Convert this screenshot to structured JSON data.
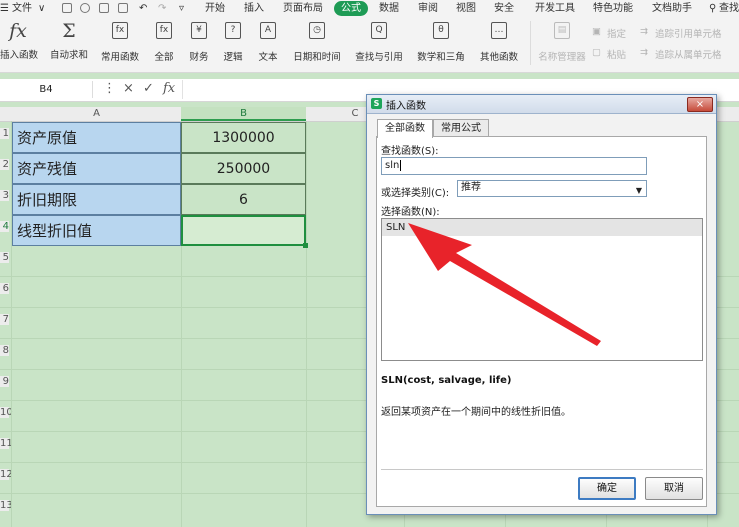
{
  "menubar": {
    "items": [
      "文件",
      "开始",
      "插入",
      "页面布局",
      "公式",
      "数据",
      "审阅",
      "视图",
      "安全",
      "开发工具",
      "特色功能",
      "文档助手",
      "查找"
    ],
    "active": "公式",
    "active_color": "#1e9b55"
  },
  "ribbon": {
    "buttons": [
      {
        "label": "插入函数",
        "icon": "fx"
      },
      {
        "label": "自动求和",
        "icon": "Σ"
      },
      {
        "label": "常用函数",
        "icon": "fx"
      },
      {
        "label": "全部",
        "icon": "fx"
      },
      {
        "label": "财务",
        "icon": "¥"
      },
      {
        "label": "逻辑",
        "icon": "?"
      },
      {
        "label": "文本",
        "icon": "A"
      },
      {
        "label": "日期和时间",
        "icon": "◷"
      },
      {
        "label": "查找与引用",
        "icon": "Q"
      },
      {
        "label": "数学和三角",
        "icon": "θ"
      },
      {
        "label": "其他函数",
        "icon": "…"
      },
      {
        "label": "名称管理器",
        "icon": "▤"
      }
    ],
    "side": [
      "指定",
      "粘贴",
      "追踪引用单元格",
      "追踪从属单元格"
    ]
  },
  "formula_bar": {
    "name_box": "B4",
    "cancel": "×",
    "confirm": "✓",
    "fx": "fx",
    "content": ""
  },
  "sheet": {
    "columns": [
      "A",
      "B",
      "C"
    ],
    "row_numbers": [
      "1",
      "2",
      "3",
      "4",
      "5",
      "6",
      "7",
      "8",
      "9",
      "10",
      "11",
      "12",
      "13"
    ],
    "rows": [
      {
        "label": "资产原值",
        "value": "1300000"
      },
      {
        "label": "资产残值",
        "value": "250000"
      },
      {
        "label": "折旧期限",
        "value": "6"
      },
      {
        "label": "线型折旧值",
        "value": ""
      }
    ]
  },
  "dialog": {
    "title": "插入函数",
    "close": "×",
    "tabs": [
      "全部函数",
      "常用公式"
    ],
    "search_label": "查找函数(S):",
    "search_value": "sln",
    "category_label": "或选择类别(C):",
    "category_value": "推荐",
    "list_label": "选择函数(N):",
    "functions": [
      "SLN"
    ],
    "signature": "SLN(cost, salvage, life)",
    "description": "返回某项资产在一个期间中的线性折旧值。",
    "ok": "确定",
    "cancel": "取消"
  },
  "colors": {
    "sheet_bg": "#c9e4c7",
    "label_fill": "#b8d6ef",
    "arrow": "#e8232a"
  }
}
